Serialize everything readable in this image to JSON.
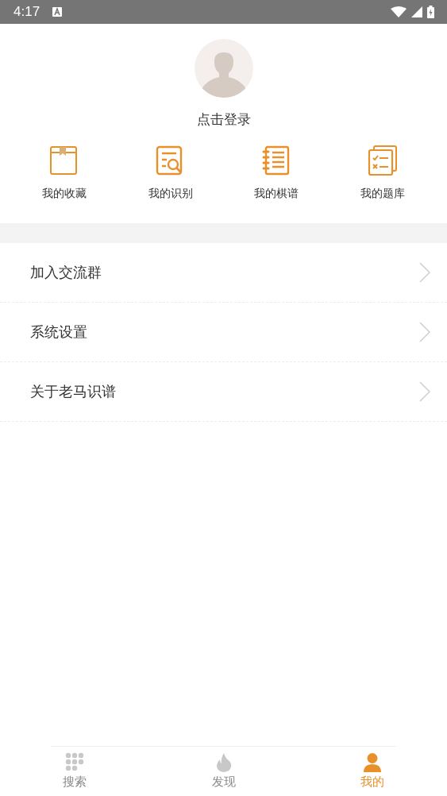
{
  "status_bar": {
    "time": "4:17"
  },
  "profile": {
    "login": "点击登录"
  },
  "shortcuts": [
    {
      "label": "我的收藏"
    },
    {
      "label": "我的识别"
    },
    {
      "label": "我的棋谱"
    },
    {
      "label": "我的题库"
    }
  ],
  "menu": [
    {
      "label": "加入交流群"
    },
    {
      "label": "系统设置"
    },
    {
      "label": "关于老马识谱"
    }
  ],
  "tabs": [
    {
      "label": "搜索",
      "selected": false
    },
    {
      "label": "发现",
      "selected": false
    },
    {
      "label": "我的",
      "selected": true
    }
  ]
}
